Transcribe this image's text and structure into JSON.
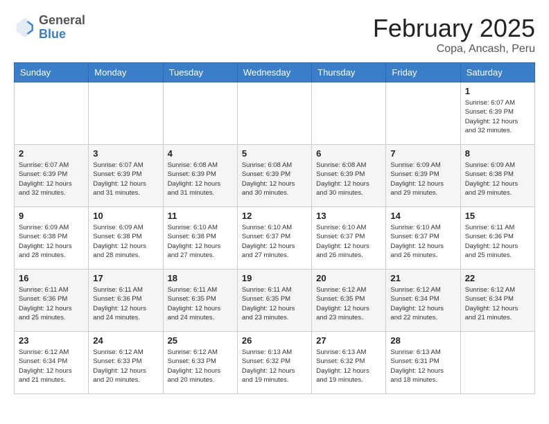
{
  "header": {
    "logo": {
      "general": "General",
      "blue": "Blue"
    },
    "title": "February 2025",
    "subtitle": "Copa, Ancash, Peru"
  },
  "weekdays": [
    "Sunday",
    "Monday",
    "Tuesday",
    "Wednesday",
    "Thursday",
    "Friday",
    "Saturday"
  ],
  "weeks": [
    [
      {
        "day": "",
        "info": ""
      },
      {
        "day": "",
        "info": ""
      },
      {
        "day": "",
        "info": ""
      },
      {
        "day": "",
        "info": ""
      },
      {
        "day": "",
        "info": ""
      },
      {
        "day": "",
        "info": ""
      },
      {
        "day": "1",
        "info": "Sunrise: 6:07 AM\nSunset: 6:39 PM\nDaylight: 12 hours and 32 minutes."
      }
    ],
    [
      {
        "day": "2",
        "info": "Sunrise: 6:07 AM\nSunset: 6:39 PM\nDaylight: 12 hours and 32 minutes."
      },
      {
        "day": "3",
        "info": "Sunrise: 6:07 AM\nSunset: 6:39 PM\nDaylight: 12 hours and 31 minutes."
      },
      {
        "day": "4",
        "info": "Sunrise: 6:08 AM\nSunset: 6:39 PM\nDaylight: 12 hours and 31 minutes."
      },
      {
        "day": "5",
        "info": "Sunrise: 6:08 AM\nSunset: 6:39 PM\nDaylight: 12 hours and 30 minutes."
      },
      {
        "day": "6",
        "info": "Sunrise: 6:08 AM\nSunset: 6:39 PM\nDaylight: 12 hours and 30 minutes."
      },
      {
        "day": "7",
        "info": "Sunrise: 6:09 AM\nSunset: 6:39 PM\nDaylight: 12 hours and 29 minutes."
      },
      {
        "day": "8",
        "info": "Sunrise: 6:09 AM\nSunset: 6:38 PM\nDaylight: 12 hours and 29 minutes."
      }
    ],
    [
      {
        "day": "9",
        "info": "Sunrise: 6:09 AM\nSunset: 6:38 PM\nDaylight: 12 hours and 28 minutes."
      },
      {
        "day": "10",
        "info": "Sunrise: 6:09 AM\nSunset: 6:38 PM\nDaylight: 12 hours and 28 minutes."
      },
      {
        "day": "11",
        "info": "Sunrise: 6:10 AM\nSunset: 6:38 PM\nDaylight: 12 hours and 27 minutes."
      },
      {
        "day": "12",
        "info": "Sunrise: 6:10 AM\nSunset: 6:37 PM\nDaylight: 12 hours and 27 minutes."
      },
      {
        "day": "13",
        "info": "Sunrise: 6:10 AM\nSunset: 6:37 PM\nDaylight: 12 hours and 26 minutes."
      },
      {
        "day": "14",
        "info": "Sunrise: 6:10 AM\nSunset: 6:37 PM\nDaylight: 12 hours and 26 minutes."
      },
      {
        "day": "15",
        "info": "Sunrise: 6:11 AM\nSunset: 6:36 PM\nDaylight: 12 hours and 25 minutes."
      }
    ],
    [
      {
        "day": "16",
        "info": "Sunrise: 6:11 AM\nSunset: 6:36 PM\nDaylight: 12 hours and 25 minutes."
      },
      {
        "day": "17",
        "info": "Sunrise: 6:11 AM\nSunset: 6:36 PM\nDaylight: 12 hours and 24 minutes."
      },
      {
        "day": "18",
        "info": "Sunrise: 6:11 AM\nSunset: 6:35 PM\nDaylight: 12 hours and 24 minutes."
      },
      {
        "day": "19",
        "info": "Sunrise: 6:11 AM\nSunset: 6:35 PM\nDaylight: 12 hours and 23 minutes."
      },
      {
        "day": "20",
        "info": "Sunrise: 6:12 AM\nSunset: 6:35 PM\nDaylight: 12 hours and 23 minutes."
      },
      {
        "day": "21",
        "info": "Sunrise: 6:12 AM\nSunset: 6:34 PM\nDaylight: 12 hours and 22 minutes."
      },
      {
        "day": "22",
        "info": "Sunrise: 6:12 AM\nSunset: 6:34 PM\nDaylight: 12 hours and 21 minutes."
      }
    ],
    [
      {
        "day": "23",
        "info": "Sunrise: 6:12 AM\nSunset: 6:34 PM\nDaylight: 12 hours and 21 minutes."
      },
      {
        "day": "24",
        "info": "Sunrise: 6:12 AM\nSunset: 6:33 PM\nDaylight: 12 hours and 20 minutes."
      },
      {
        "day": "25",
        "info": "Sunrise: 6:12 AM\nSunset: 6:33 PM\nDaylight: 12 hours and 20 minutes."
      },
      {
        "day": "26",
        "info": "Sunrise: 6:13 AM\nSunset: 6:32 PM\nDaylight: 12 hours and 19 minutes."
      },
      {
        "day": "27",
        "info": "Sunrise: 6:13 AM\nSunset: 6:32 PM\nDaylight: 12 hours and 19 minutes."
      },
      {
        "day": "28",
        "info": "Sunrise: 6:13 AM\nSunset: 6:31 PM\nDaylight: 12 hours and 18 minutes."
      },
      {
        "day": "",
        "info": ""
      }
    ]
  ]
}
